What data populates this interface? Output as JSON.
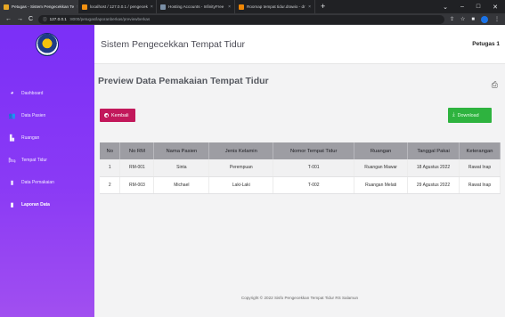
{
  "browser": {
    "tabs": [
      {
        "label": "Petugas - Sistem Pengecekkan Te",
        "active": true,
        "fav_color": "#e8a825"
      },
      {
        "label": "localhost / 127.0.0.1 / pengecek",
        "active": false,
        "fav_color": "#f29111"
      },
      {
        "label": "Hosting Accounts - InfinityFree",
        "active": false,
        "fav_color": "#7a8fa6"
      },
      {
        "label": "Roomap tempat tidur.drawio - dr",
        "active": false,
        "fav_color": "#f08705"
      }
    ],
    "new_tab": "+",
    "url_host": "127.0.0.1",
    "url_path": ":8000/petugas/laporanberkas/previewberkas"
  },
  "app": {
    "title": "Sistem Pengecekkan Tempat Tidur",
    "user": "Petugas 1"
  },
  "sidebar": {
    "items": [
      {
        "label": "Dashboard",
        "icon": "dashboard-icon",
        "glyph": "◕",
        "active": false
      },
      {
        "label": "Data Pasien",
        "icon": "users-icon",
        "glyph": "👥",
        "active": false
      },
      {
        "label": "Ruangan",
        "icon": "building-icon",
        "glyph": "▙",
        "active": false
      },
      {
        "label": "Tempat Tidur",
        "icon": "bed-icon",
        "glyph": "🛏",
        "active": false
      },
      {
        "label": "Data Pemakaian",
        "icon": "file-icon",
        "glyph": "▮",
        "active": false
      },
      {
        "label": "Laporan Data",
        "icon": "report-icon",
        "glyph": "▮",
        "active": true
      }
    ]
  },
  "main": {
    "page_title": "Preview Data Pemakaian Tempat Tidur",
    "back_label": "Kembali",
    "download_label": "Download",
    "table": {
      "headers": [
        "No",
        "No RM",
        "Nama Pasien",
        "Jenis Kelamin",
        "Nomor Tempat Tidur",
        "Ruangan",
        "Tanggal Pakai",
        "Keterangan"
      ],
      "rows": [
        [
          "1",
          "RM-001",
          "Sinta",
          "Perempuan",
          "T-001",
          "Ruangan Mawar",
          "18 Agustus 2022",
          "Rawat Inap"
        ],
        [
          "2",
          "RM-003",
          "Michael",
          "Laki-Laki",
          "T-002",
          "Ruangan Melati",
          "29 Agustus 2022",
          "Rawat Inap"
        ]
      ]
    }
  },
  "footer": {
    "text": "Copyright © 2022 Sisfo Pengecekkan Tempat Tidur RS Salamun"
  },
  "colors": {
    "sidebar": "#8a3af5",
    "back_button": "#c2185b",
    "download_button": "#2eb33f",
    "table_header": "#9d9da3"
  }
}
